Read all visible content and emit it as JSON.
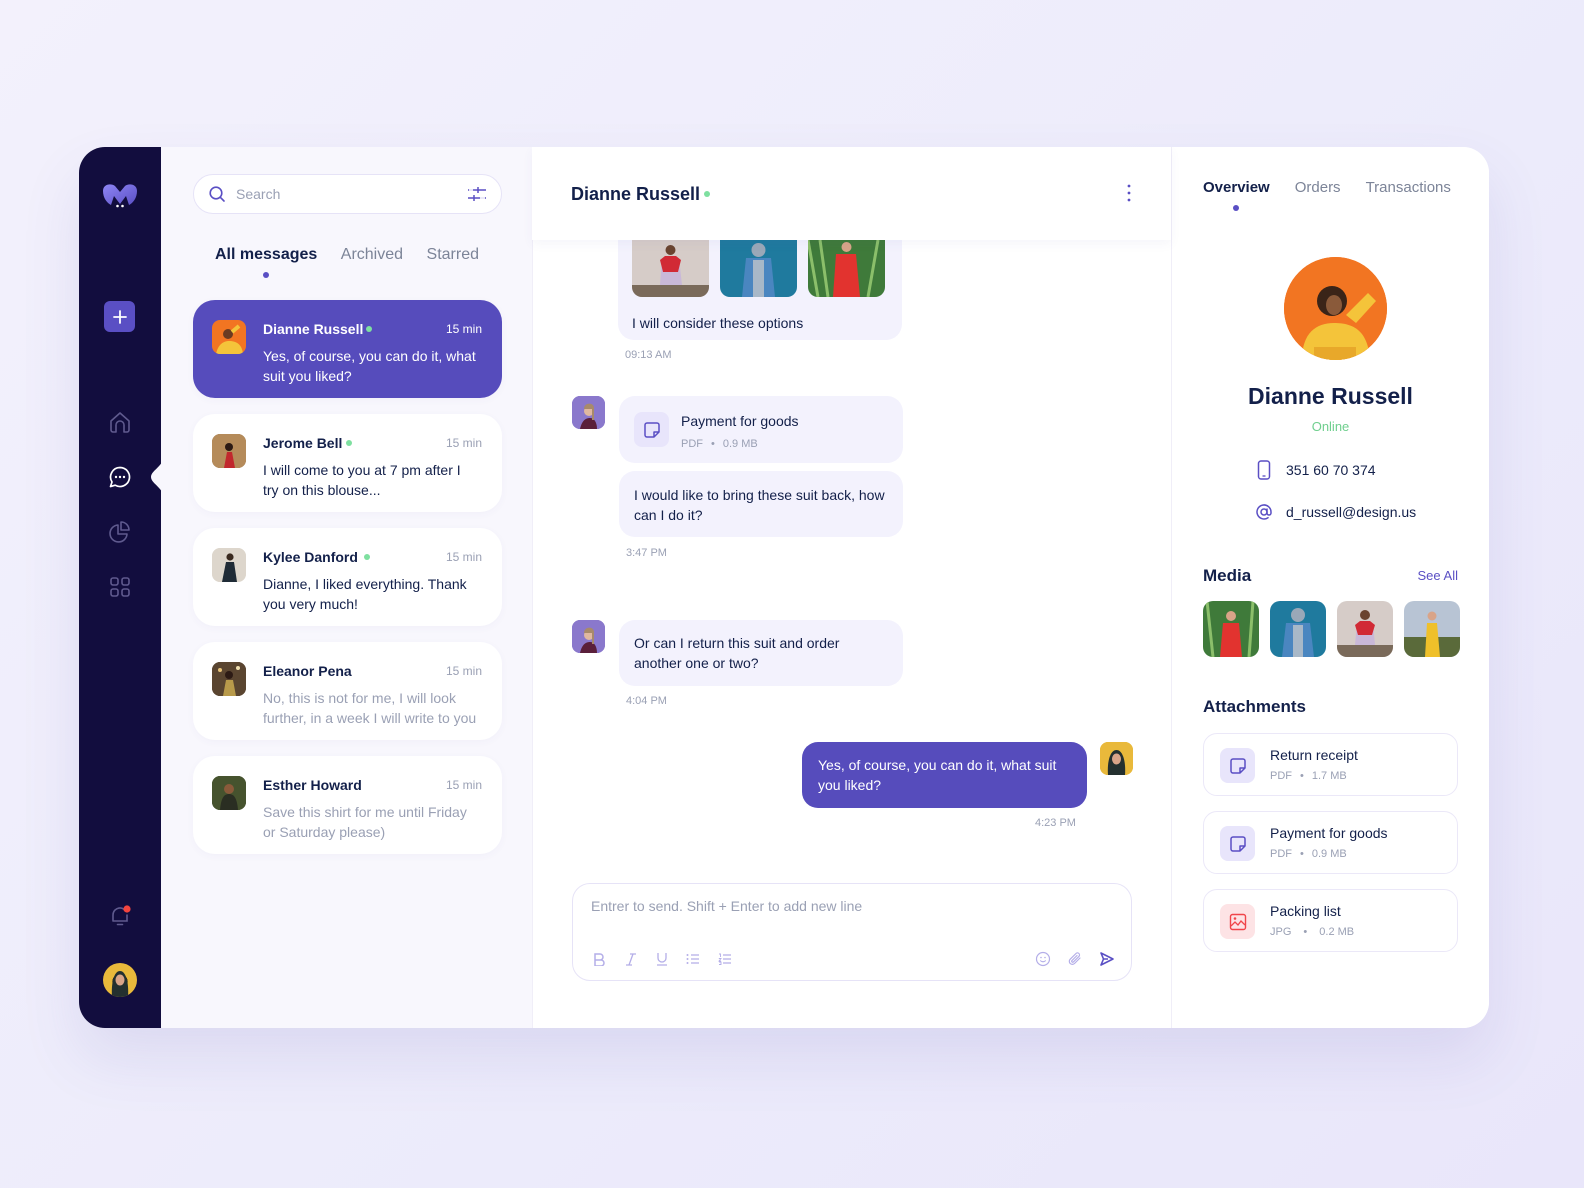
{
  "sidebar": {
    "logo": "brand-logo",
    "add_button": "plus-icon",
    "items": [
      {
        "name": "home",
        "icon": "home-icon",
        "active": false
      },
      {
        "name": "messages",
        "icon": "chat-bubble-icon",
        "active": true
      },
      {
        "name": "analytics",
        "icon": "pie-chart-icon",
        "active": false
      },
      {
        "name": "apps",
        "icon": "grid-icon",
        "active": false
      }
    ],
    "notifications_icon": "bell-icon",
    "has_notification": true
  },
  "chat_list": {
    "search": {
      "placeholder": "Search",
      "value": ""
    },
    "tabs": [
      {
        "label": "All messages",
        "active": true
      },
      {
        "label": "Archived",
        "active": false
      },
      {
        "label": "Starred",
        "active": false
      }
    ],
    "threads": [
      {
        "name": "Dianne Russell",
        "online": true,
        "time": "15 min",
        "preview": "Yes, of course, you can do it, what suit you liked?",
        "active": true,
        "read": false
      },
      {
        "name": "Jerome Bell",
        "online": true,
        "time": "15 min",
        "preview": "I will come to you at 7 pm after I try on this blouse...",
        "active": false,
        "read": false
      },
      {
        "name": "Kylee Danford",
        "online": true,
        "time": "15 min",
        "preview": "Dianne, I liked everything. Thank you very much!",
        "active": false,
        "read": false
      },
      {
        "name": "Eleanor Pena",
        "online": false,
        "time": "15 min",
        "preview": "No, this is not for me, I will look further, in a week I will write to you",
        "active": false,
        "read": true
      },
      {
        "name": "Esther Howard",
        "online": false,
        "time": "15 min",
        "preview": "Save this shirt for me until Friday or Saturday please)",
        "active": false,
        "read": true
      }
    ]
  },
  "chat": {
    "title": "Dianne Russell",
    "online": true,
    "messages": [
      {
        "type": "photos",
        "text": "I will consider these options",
        "time": "09:13 AM",
        "photo_count": 3
      },
      {
        "type": "file",
        "file_name": "Payment for goods",
        "file_type": "PDF",
        "file_size": "0.9 MB"
      },
      {
        "type": "text",
        "text": "I would like to bring these suit back, how can I do it?",
        "time": "3:47 PM"
      },
      {
        "type": "text",
        "text": "Or can I return this suit and order another one or two?",
        "time": "4:04 PM"
      },
      {
        "type": "text",
        "mine": true,
        "text": "Yes, of course, you can do it, what suit you liked?",
        "time": "4:23 PM"
      }
    ],
    "composer": {
      "placeholder": "Entrer to send. Shift + Enter to add new line",
      "value": "",
      "tools": [
        "bold-icon",
        "italic-icon",
        "underline-icon",
        "bullet-list-icon",
        "numbered-list-icon"
      ],
      "actions": [
        "emoji-icon",
        "attach-icon",
        "send-icon"
      ]
    }
  },
  "profile": {
    "tabs": [
      {
        "label": "Overview",
        "active": true
      },
      {
        "label": "Orders",
        "active": false
      },
      {
        "label": "Transactions",
        "active": false
      }
    ],
    "name": "Dianne Russell",
    "status": "Online",
    "phone": "351 60 70 374",
    "email": "d_russell@design.us",
    "media_title": "Media",
    "see_all": "See All",
    "media_count": 4,
    "attachments_title": "Attachments",
    "attachments": [
      {
        "name": "Return receipt",
        "type": "PDF",
        "size": "1.7 MB",
        "icon": "document-icon"
      },
      {
        "name": "Payment for goods",
        "type": "PDF",
        "size": "0.9 MB",
        "icon": "document-icon"
      },
      {
        "name": "Packing list",
        "type": "JPG",
        "size": "0.2 MB",
        "icon": "image-icon"
      }
    ]
  },
  "colors": {
    "accent": "#564cbc",
    "sidebar_bg": "#120d3e",
    "online": "#7ee0a0",
    "text": "#13204a",
    "muted": "#9aa0b4",
    "image_file": "#fde3e5"
  }
}
